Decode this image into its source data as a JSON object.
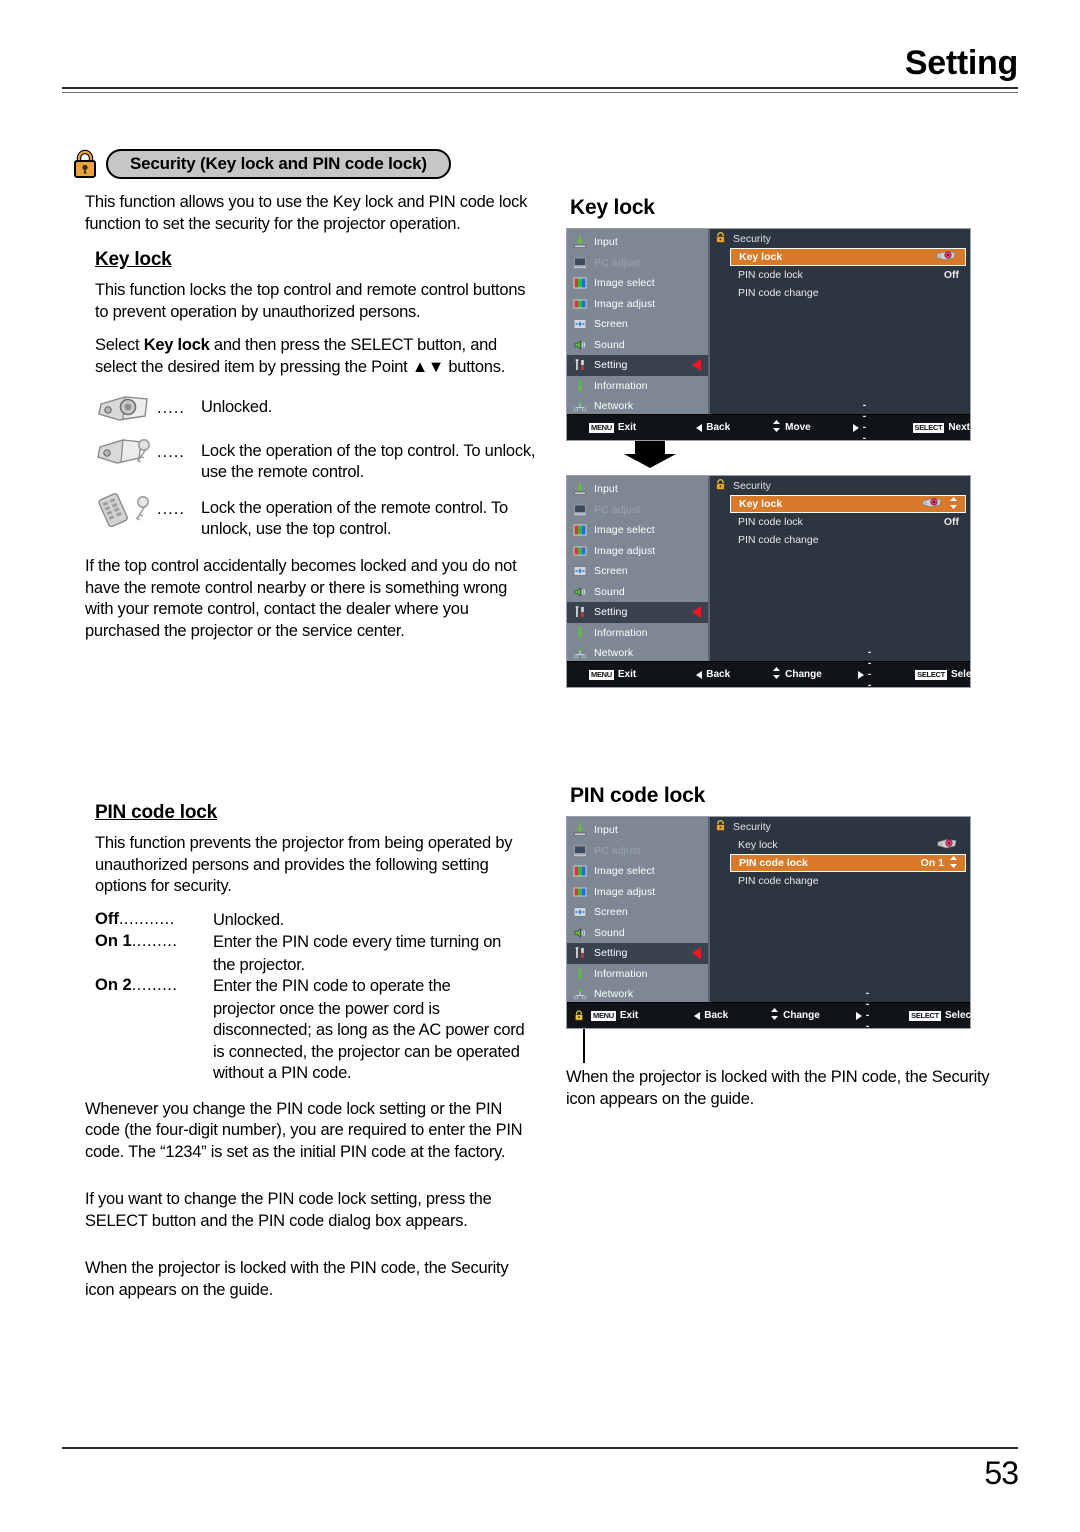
{
  "header": {
    "title": "Setting"
  },
  "banner": {
    "icon": "padlock-icon",
    "label": "Security (Key lock and PIN code lock)"
  },
  "intro": "This function allows you to use the Key lock and PIN code lock function to set the security for the projector operation.",
  "keylock_section": {
    "heading": "Key lock",
    "para1": "This function locks the top control and remote control buttons to prevent operation by unauthorized persons.",
    "para2_a": "Select ",
    "para2_b": "Key lock",
    "para2_c": " and then press the SELECT button, and select the desired item by pressing the Point ▲▼ buttons.",
    "legend": [
      {
        "icon": "projector-unlocked-icon",
        "dots": ".....",
        "text": "Unlocked."
      },
      {
        "icon": "projector-key-icon",
        "dots": ".....",
        "text": "Lock the operation of the top control. To unlock, use the remote control."
      },
      {
        "icon": "remote-key-icon",
        "dots": ".....",
        "text": "Lock the operation of the remote control.    To unlock, use the top control."
      }
    ],
    "para3": "If the top control accidentally becomes locked and you do not have the remote control nearby or there is something wrong with your remote control, contact the dealer where you purchased the projector or the service center."
  },
  "pincode_section": {
    "heading": "PIN code lock",
    "para1": "This function prevents the projector from being operated by unauthorized persons and provides the following setting options for security.",
    "options": [
      {
        "term": "Off",
        "dots": "...........",
        "desc": "Unlocked.",
        "cont": ""
      },
      {
        "term": "On 1",
        "dots": ".........",
        "desc": "Enter the PIN code every time turning on",
        "cont": "the projector."
      },
      {
        "term": "On 2",
        "dots": ".........",
        "desc": "Enter the PIN code to operate the",
        "cont": "projector once the power cord is disconnected; as long as the AC power cord is connected, the projector can be operated without a PIN code."
      }
    ],
    "para2": "Whenever you change the PIN code lock setting or the PIN code (the four-digit number), you are required to enter the PIN code. The “1234” is set as the initial PIN code at the factory.",
    "para3": "If you want to change the PIN code lock setting, press the SELECT button and the PIN code dialog box appears.",
    "para4": "When the projector is locked with the PIN code, the Security icon appears on the guide."
  },
  "osd_common": {
    "sidebar": [
      {
        "label": "Input",
        "icon": "input-icon",
        "state": "normal"
      },
      {
        "label": "PC adjust",
        "icon": "pc-adjust-icon",
        "state": "dim"
      },
      {
        "label": "Image select",
        "icon": "image-select-icon",
        "state": "normal"
      },
      {
        "label": "Image adjust",
        "icon": "image-adjust-icon",
        "state": "normal"
      },
      {
        "label": "Screen",
        "icon": "screen-icon",
        "state": "normal"
      },
      {
        "label": "Sound",
        "icon": "sound-icon",
        "state": "normal"
      },
      {
        "label": "Setting",
        "icon": "setting-icon",
        "state": "selected"
      },
      {
        "label": "Information",
        "icon": "information-icon",
        "state": "normal"
      },
      {
        "label": "Network",
        "icon": "network-icon",
        "state": "normal"
      }
    ],
    "panel_title": "Security",
    "panel_icon": "padlock-icon",
    "rows": {
      "key_lock": "Key lock",
      "pin_code_lock": "PIN code lock",
      "pin_code_change": "PIN code change"
    }
  },
  "osd1": {
    "caption": "Key lock",
    "key_lock_value_icon": "projector-lock-icon",
    "pin_code_lock_value": "Off",
    "active_row": "Key lock",
    "footer": {
      "exit_key": "MENU",
      "exit": "Exit",
      "back": "Back",
      "move": "Move",
      "dash": "-----",
      "select_key": "SELECT",
      "select": "Next"
    }
  },
  "osd2": {
    "key_lock_value_icon": "projector-lock-icon",
    "pin_code_lock_value": "Off",
    "active_row": "Key lock",
    "footer": {
      "exit_key": "MENU",
      "exit": "Exit",
      "back": "Back",
      "move": "Change",
      "dash": "-----",
      "select_key": "SELECT",
      "select": "Select"
    }
  },
  "osd3": {
    "caption": "PIN code lock",
    "key_lock_value_icon": "projector-lock-icon",
    "pin_code_lock_value": "On 1",
    "active_row": "PIN code lock",
    "footer": {
      "security_icon": "security-lock-icon",
      "exit_key": "MENU",
      "exit": "Exit",
      "back": "Back",
      "move": "Change",
      "dash": "-----",
      "select_key": "SELECT",
      "select": "Select"
    },
    "note": "When the projector is locked with the PIN code, the Security icon appears on the guide."
  },
  "footer": {
    "page_number": "53"
  },
  "colors": {
    "highlight": "#d97a2b",
    "sidebar_bg": "#7d8894",
    "panel_bg": "#2d3540",
    "footer_bg": "#101419",
    "caret": "#e02020",
    "lock_gold": "#e8a33d"
  }
}
